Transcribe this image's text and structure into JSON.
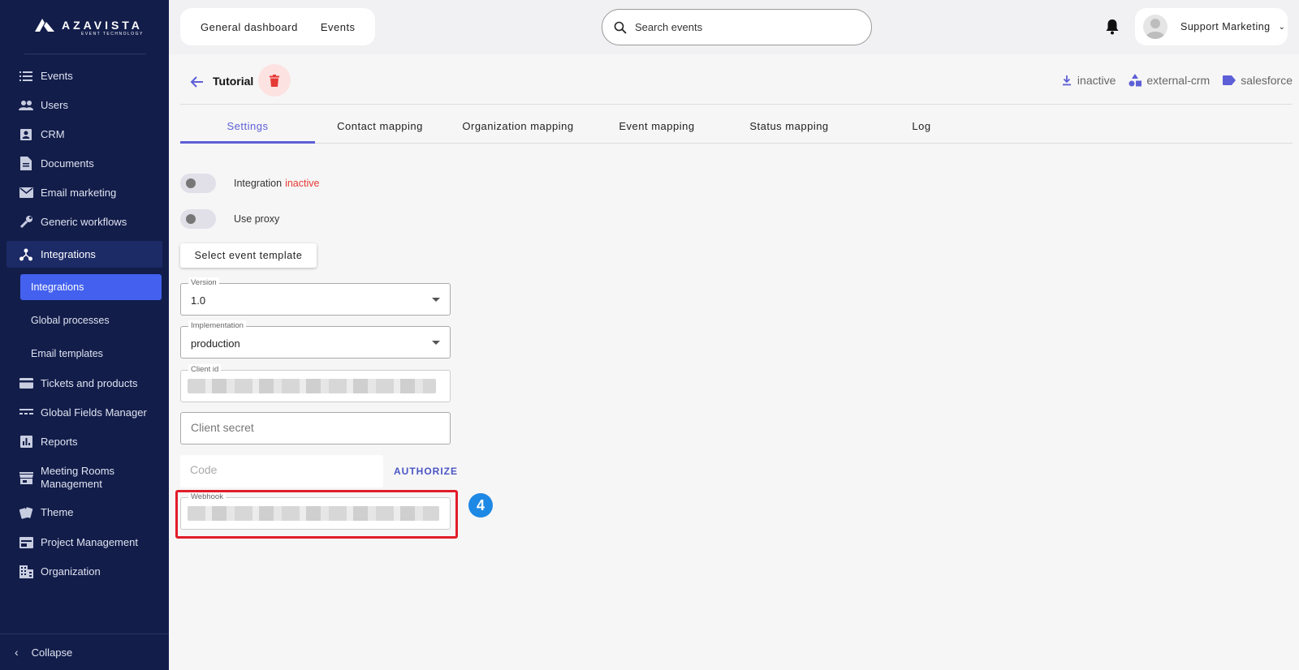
{
  "brand": {
    "name": "AZAVISTA",
    "tagline": "EVENT TECHNOLOGY"
  },
  "sidebar": {
    "items": [
      {
        "label": "Events",
        "icon": "list-icon"
      },
      {
        "label": "Users",
        "icon": "people-icon"
      },
      {
        "label": "CRM",
        "icon": "contact-card-icon"
      },
      {
        "label": "Documents",
        "icon": "document-icon"
      },
      {
        "label": "Email marketing",
        "icon": "mail-icon"
      },
      {
        "label": "Generic workflows",
        "icon": "wrench-icon"
      },
      {
        "label": "Integrations",
        "icon": "hub-icon"
      },
      {
        "label": "Tickets and products",
        "icon": "card-icon"
      },
      {
        "label": "Global Fields Manager",
        "icon": "fields-icon"
      },
      {
        "label": "Reports",
        "icon": "chart-icon"
      },
      {
        "label": "Meeting Rooms Management",
        "icon": "store-icon"
      },
      {
        "label": "Theme",
        "icon": "palette-icon"
      },
      {
        "label": "Project Management",
        "icon": "board-icon"
      },
      {
        "label": "Organization",
        "icon": "building-icon"
      }
    ],
    "sub_items": [
      {
        "label": "Integrations"
      },
      {
        "label": "Global processes"
      },
      {
        "label": "Email templates"
      }
    ],
    "collapse_label": "Collapse"
  },
  "topbar": {
    "tabs": [
      "General dashboard",
      "Events"
    ],
    "search_placeholder": "Search events",
    "user_name": "Support Marketing"
  },
  "page": {
    "title": "Tutorial",
    "meta": [
      {
        "label": "inactive",
        "icon": "download-icon"
      },
      {
        "label": "external-crm",
        "icon": "shapes-icon"
      },
      {
        "label": "salesforce",
        "icon": "tag-icon"
      }
    ],
    "tabs": [
      "Settings",
      "Contact mapping",
      "Organization mapping",
      "Event mapping",
      "Status mapping",
      "Log"
    ],
    "active_tab": "Settings"
  },
  "form": {
    "integration_label": "Integration",
    "integration_status": "inactive",
    "proxy_label": "Use proxy",
    "template_button": "Select event template",
    "version_label": "Version",
    "version_value": "1.0",
    "implementation_label": "Implementation",
    "implementation_value": "production",
    "client_id_label": "Client id",
    "client_secret_placeholder": "Client secret",
    "code_placeholder": "Code",
    "authorize_label": "AUTHORIZE",
    "webhook_label": "Webhook"
  },
  "annotation": {
    "step": "4",
    "color": "#e11d2a",
    "badge_color": "#1e88e5"
  },
  "colors": {
    "sidebar_bg": "#121d4a",
    "accent": "#5d5fd6",
    "active_sub": "#4361ee",
    "danger": "#e53935"
  }
}
